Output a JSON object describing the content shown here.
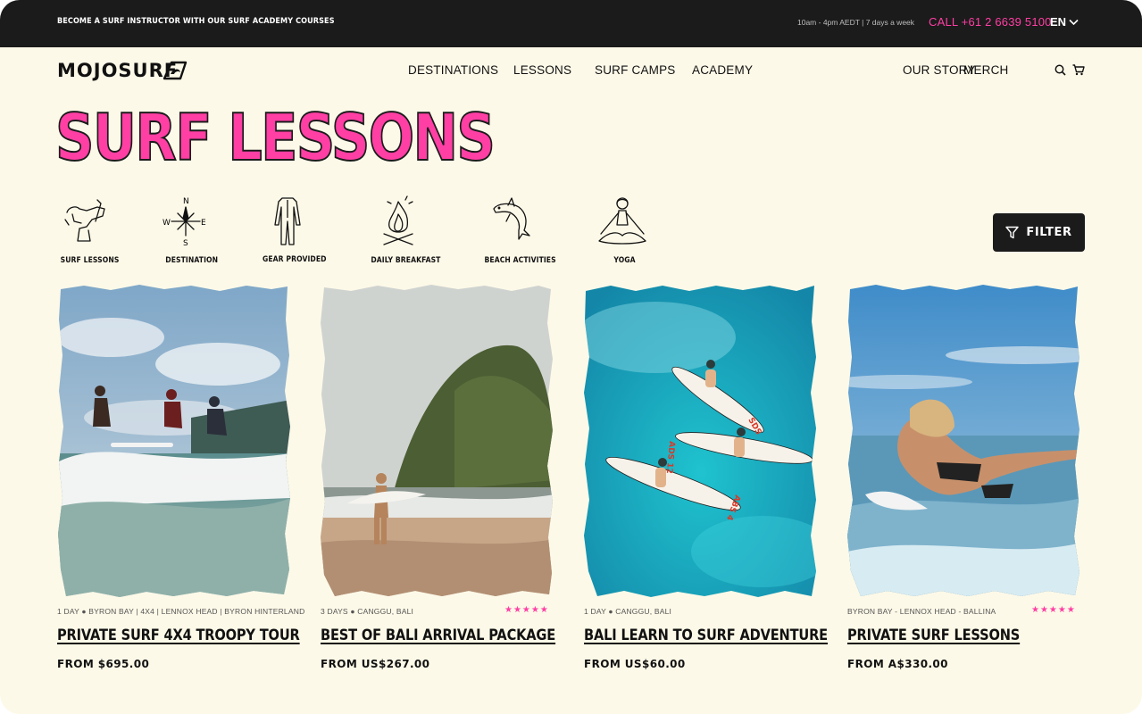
{
  "topbar": {
    "promo": "BECOME A SURF INSTRUCTOR WITH OUR SURF ACADEMY COURSES",
    "hours": "10am - 4pm AEDT | 7 days a week",
    "phone": "CALL +61 2 6639 5100",
    "language": "EN"
  },
  "header": {
    "logo": "MOJOSURF",
    "nav": [
      "DESTINATIONS",
      "LESSONS",
      "SURF CAMPS",
      "ACADEMY"
    ],
    "secondary_nav": [
      "OUR STORY",
      "MERCH"
    ],
    "icons": [
      "search-icon",
      "cart-icon"
    ]
  },
  "page": {
    "title": "SURF LESSONS",
    "filter_label": "FILTER"
  },
  "categories": [
    {
      "label": "SURF LESSONS",
      "icon": "surf-lessons-icon"
    },
    {
      "label": "DESTINATION",
      "icon": "compass-icon"
    },
    {
      "label": "GEAR PROVIDED",
      "icon": "wetsuit-icon"
    },
    {
      "label": "DAILY BREAKFAST",
      "icon": "campfire-icon"
    },
    {
      "label": "BEACH ACTIVITIES",
      "icon": "dolphin-icon"
    },
    {
      "label": "YOGA",
      "icon": "yoga-icon"
    }
  ],
  "cards": [
    {
      "meta": "1 DAY  ●  BYRON BAY | 4X4 | LENNOX HEAD | BYRON HINTERLAND",
      "stars": "",
      "title": "PRIVATE SURF 4X4 TROOPY TOUR",
      "price": "FROM $695.00"
    },
    {
      "meta": "3 DAYS  ●  CANGGU, BALI",
      "stars": "★★★★★",
      "title": "BEST OF BALI ARRIVAL PACKAGE",
      "price": "FROM US$267.00"
    },
    {
      "meta": "1 DAY  ●  CANGGU, BALI",
      "stars": "",
      "title": "BALI LEARN TO SURF ADVENTURE",
      "price": "FROM US$60.00"
    },
    {
      "meta": "BYRON BAY - LENNOX HEAD - BALLINA",
      "stars": "★★★★★",
      "title": "PRIVATE SURF LESSONS",
      "price": "FROM A$330.00"
    }
  ],
  "colors": {
    "accent": "#ff3fa4",
    "dark": "#1b1b1b",
    "background": "#fdf9e8"
  }
}
